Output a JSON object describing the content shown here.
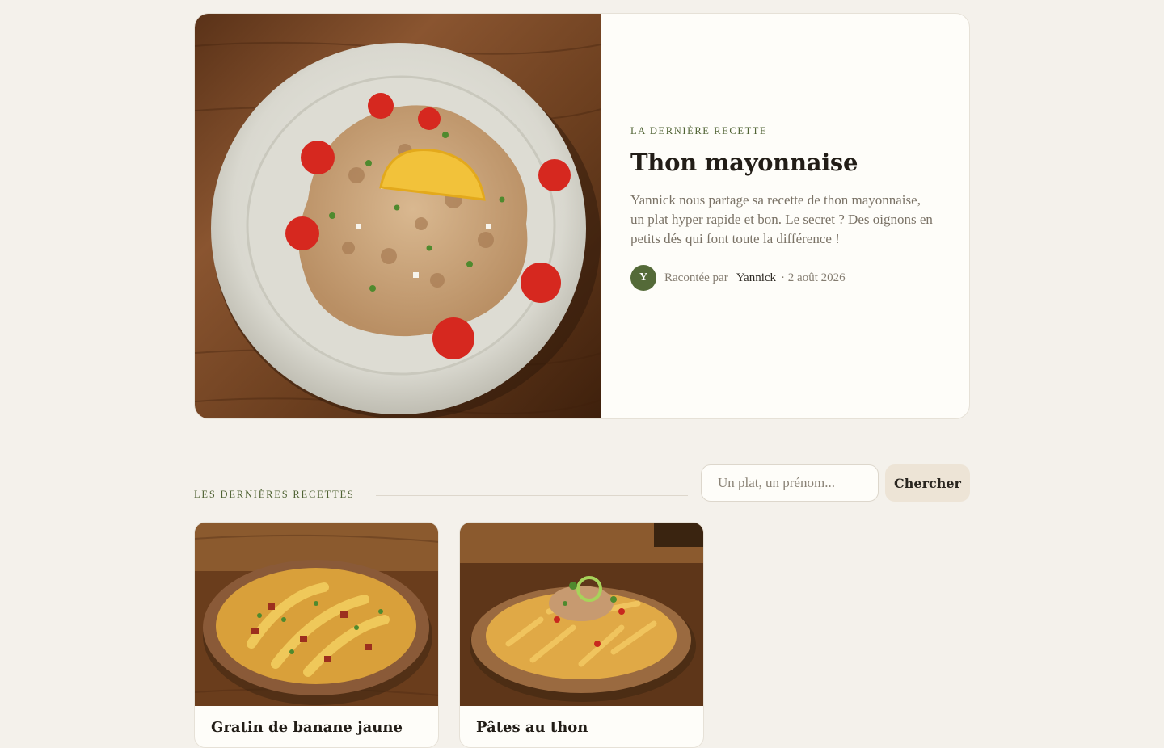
{
  "featured": {
    "eyebrow": "LA DERNIÈRE RECETTE",
    "title": "Thon mayonnaise",
    "description": "Yannick nous partage sa recette de thon mayonnaise, un plat hyper rapide et bon. Le secret ? Des oignons en petits dés qui font toute la différence !",
    "avatar_initial": "Y",
    "byline_prefix": "Racontée par",
    "author": "Yannick",
    "date": "· 2 août 2026",
    "photo": "tuna-mayo-plate-photo"
  },
  "recipes_section": {
    "label": "LES DERNIÈRES RECETTES",
    "search_placeholder": "Un plat, un prénom...",
    "search_button": "Chercher"
  },
  "recipes": [
    {
      "title": "Gratin de banane jaune",
      "photo": "plantain-gratin-photo"
    },
    {
      "title": "Pâtes au thon",
      "photo": "tuna-pasta-photo"
    }
  ],
  "colors": {
    "page_bg": "#f4f1eb",
    "card_bg": "#fefdf9",
    "accent_green": "#4f6233",
    "avatar_green": "#546a38",
    "button_bg": "#ede4d6"
  }
}
